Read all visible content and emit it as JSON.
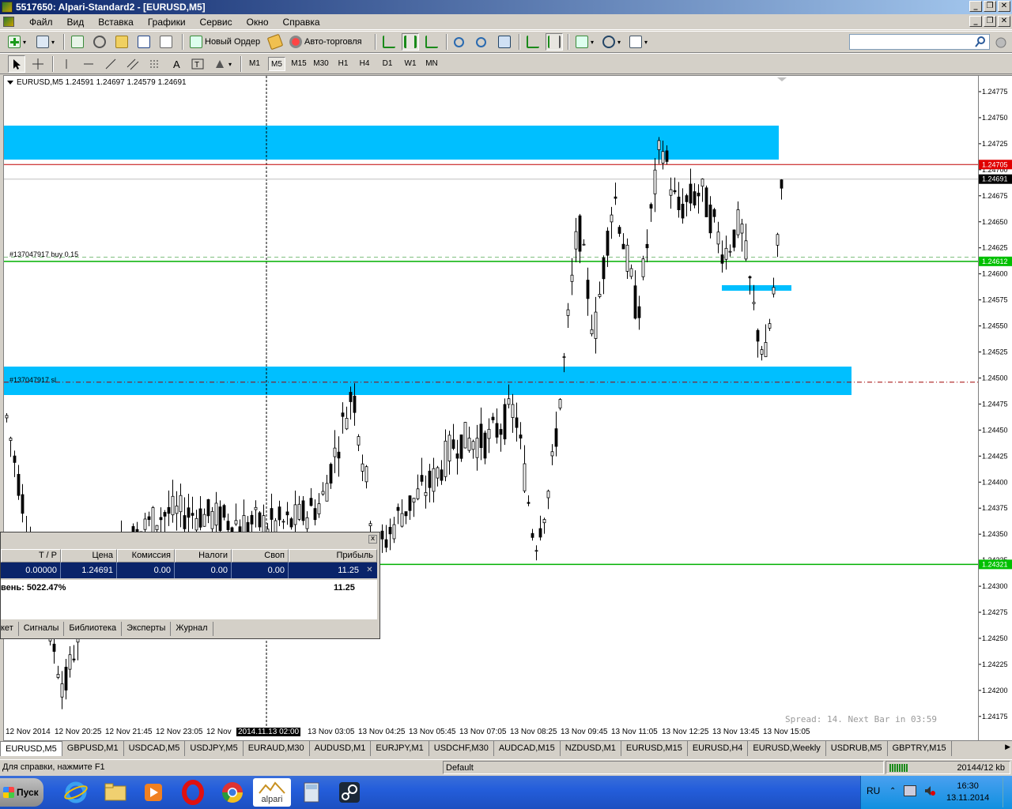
{
  "window": {
    "title": "5517650: Alpari-Standard2 - [EURUSD,M5]",
    "min_btn": "_",
    "restore_btn": "❐",
    "close_btn": "✕"
  },
  "menu": {
    "items": [
      "Файл",
      "Вид",
      "Вставка",
      "Графики",
      "Сервис",
      "Окно",
      "Справка"
    ]
  },
  "toolbar": {
    "new_order_label": "Новый Ордер",
    "auto_trading_label": "Авто-торговля",
    "search_placeholder": "",
    "timeframes": [
      "M1",
      "M5",
      "M15",
      "M30",
      "H1",
      "H4",
      "D1",
      "W1",
      "MN"
    ],
    "active_timeframe": "M5"
  },
  "chart": {
    "info": "EURUSD,M5  1.24591 1.24697 1.24579 1.24691",
    "buy_label": "#137047917 buy 0.15",
    "sl_label": "#137047917 sl",
    "spread_text": "Spread: 14. Next Bar in 03:59",
    "price_ticks": [
      "1.24775",
      "1.24750",
      "1.24725",
      "1.24700",
      "1.24675",
      "1.24650",
      "1.24625",
      "1.24600",
      "1.24575",
      "1.24550",
      "1.24525",
      "1.24500",
      "1.24475",
      "1.24450",
      "1.24425",
      "1.24400",
      "1.24375",
      "1.24350",
      "1.24325",
      "1.24300",
      "1.24275",
      "1.24250",
      "1.24225",
      "1.24200",
      "1.24175"
    ],
    "price_markers": {
      "red": "1.24705",
      "current": "1.24691",
      "green_buy": "1.24612",
      "green_tp": "1.24321"
    },
    "time_labels": [
      "12 Nov 2014",
      "12 Nov 20:25",
      "12 Nov 21:45",
      "12 Nov 23:05",
      "12 Nov",
      "2014.11.13 02:00",
      "13 Nov 03:05",
      "13 Nov 04:25",
      "13 Nov 05:45",
      "13 Nov 07:05",
      "13 Nov 08:25",
      "13 Nov 09:45",
      "13 Nov 11:05",
      "13 Nov 12:25",
      "13 Nov 13:45",
      "13 Nov 15:05"
    ],
    "colors": {
      "zone": "#00bfff",
      "buy_line": "#00b000",
      "sl_line": "#c00000",
      "bid_line": "#c0c0c0",
      "current_marker_bg": "#000000",
      "red_marker_bg": "#e00000",
      "green_marker_bg": "#00c000"
    }
  },
  "terminal": {
    "columns": [
      "T / P",
      "Цена",
      "Комиссия",
      "Налоги",
      "Своп",
      "Прибыль"
    ],
    "row": [
      "0.00000",
      "1.24691",
      "0.00",
      "0.00",
      "0.00",
      "11.25"
    ],
    "summary_label": "вень: 5022.47%",
    "summary_profit": "11.25",
    "tabs": [
      "кет",
      "Сигналы",
      "Библиотека",
      "Эксперты",
      "Журнал"
    ],
    "close_glyph": "x",
    "row_close_glyph": "✕"
  },
  "chart_tabs": [
    "EURUSD,M5",
    "GBPUSD,M1",
    "USDCAD,M5",
    "USDJPY,M5",
    "EURAUD,M30",
    "AUDUSD,M1",
    "EURJPY,M1",
    "USDCHF,M30",
    "AUDCAD,M15",
    "NZDUSD,M1",
    "EURUSD,M15",
    "EURUSD,H4",
    "EURUSD,Weekly",
    "USDRUB,M5",
    "GBPTRY,M15"
  ],
  "statusbar": {
    "help": "Для справки, нажмите F1",
    "profile": "Default",
    "traffic": "20144/12 kb"
  },
  "taskbar": {
    "start_label": "Пуск",
    "apps": [
      "internet-explorer-icon",
      "file-explorer-icon",
      "media-player-icon",
      "opera-icon",
      "chrome-icon",
      "alpari-icon",
      "calculator-icon",
      "steam-icon"
    ],
    "alpari_label": "alpari",
    "lang": "RU",
    "time": "16:30",
    "date": "13.11.2014"
  }
}
